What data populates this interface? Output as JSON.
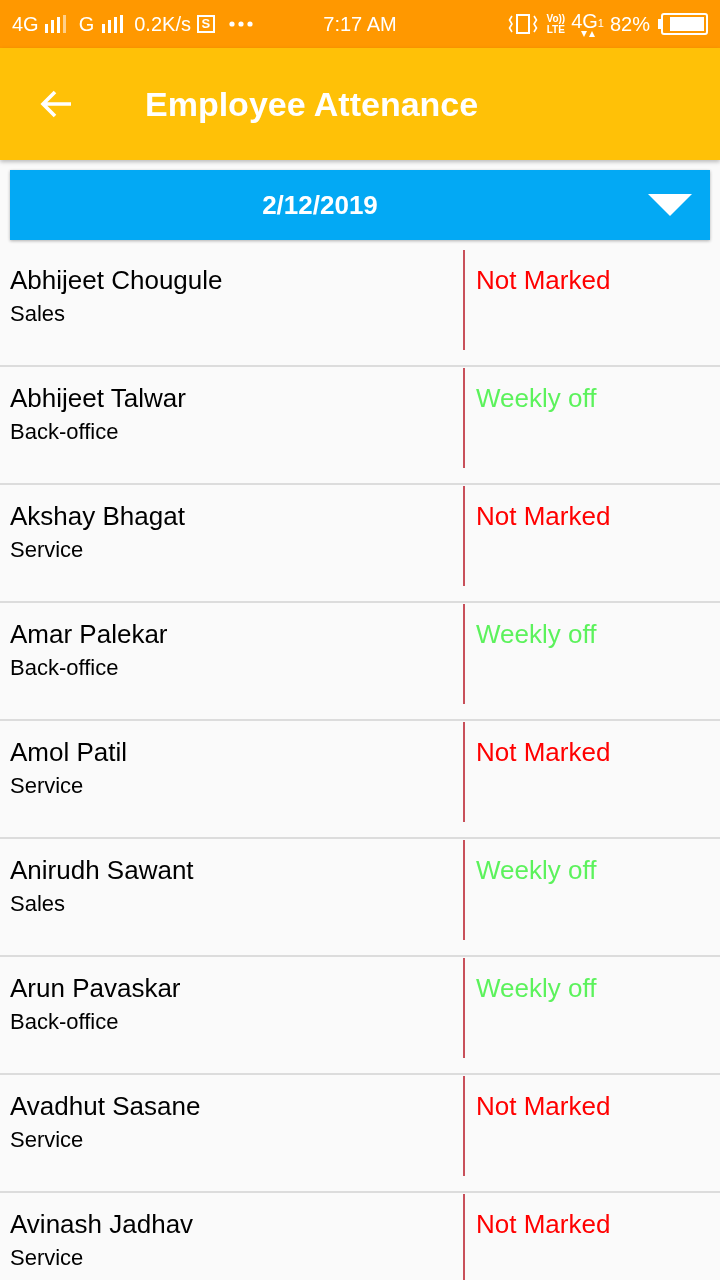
{
  "status_bar": {
    "network_1": "4G",
    "network_2": "G",
    "speed": "0.2K/s",
    "app_badge": "S",
    "time": "7:17 AM",
    "volte_top": "Vo))",
    "volte_bottom": "LTE",
    "network_3": "4G",
    "sim": "1",
    "battery": "82%"
  },
  "app_bar": {
    "title": "Employee Attenance"
  },
  "date_picker": {
    "value": "2/12/2019"
  },
  "employees": [
    {
      "name": "Abhijeet Chougule",
      "department": "Sales",
      "status": "Not Marked",
      "color": "#ff0000"
    },
    {
      "name": "Abhijeet Talwar",
      "department": "Back-office",
      "status": "Weekly off",
      "color": "#5cf25c"
    },
    {
      "name": "Akshay Bhagat",
      "department": "Service",
      "status": "Not Marked",
      "color": "#ff0000"
    },
    {
      "name": "Amar Palekar",
      "department": "Back-office",
      "status": "Weekly off",
      "color": "#5cf25c"
    },
    {
      "name": "Amol Patil",
      "department": "Service",
      "status": "Not Marked",
      "color": "#ff0000"
    },
    {
      "name": "Anirudh Sawant",
      "department": "Sales",
      "status": "Weekly off",
      "color": "#5cf25c"
    },
    {
      "name": "Arun Pavaskar",
      "department": "Back-office",
      "status": "Weekly off",
      "color": "#5cf25c"
    },
    {
      "name": "Avadhut Sasane",
      "department": "Service",
      "status": "Not Marked",
      "color": "#ff0000"
    },
    {
      "name": "Avinash Jadhav",
      "department": "Service",
      "status": "Not Marked",
      "color": "#ff0000"
    }
  ]
}
